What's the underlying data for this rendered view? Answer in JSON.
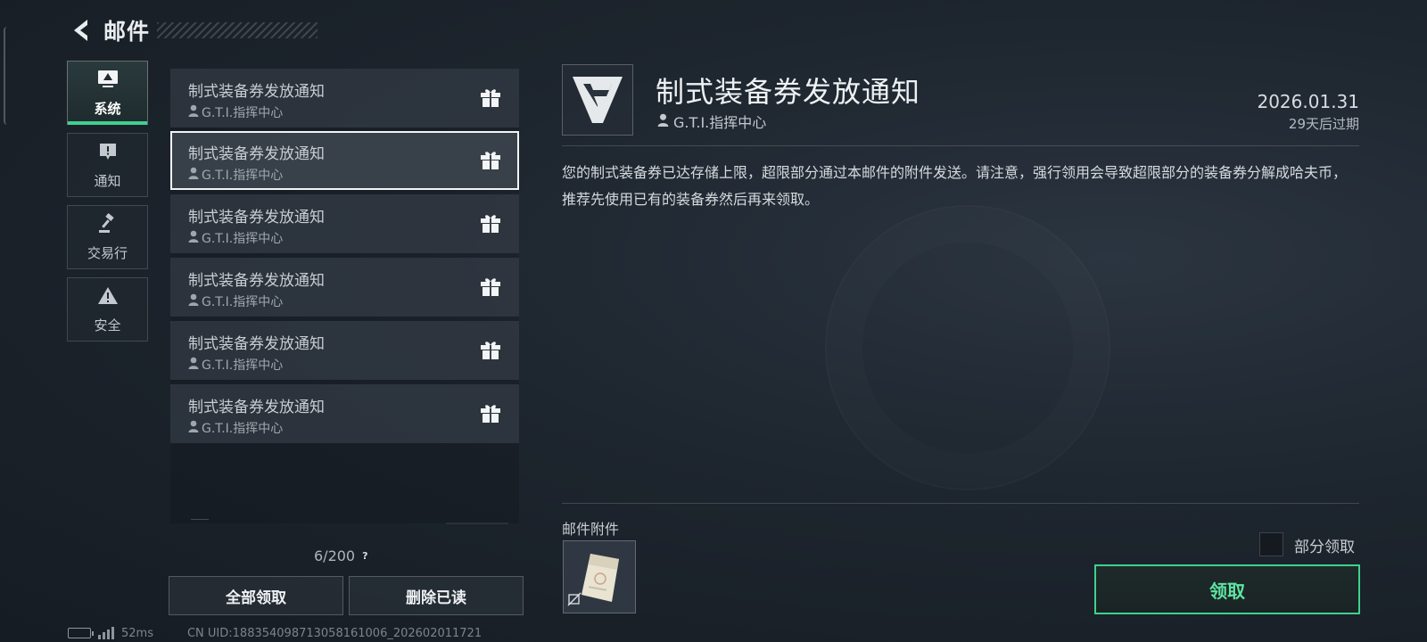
{
  "header": {
    "title": "邮件"
  },
  "categories": [
    {
      "label": "系统",
      "icon": "monitor-icon",
      "active": true
    },
    {
      "label": "通知",
      "icon": "exclamation-icon",
      "active": false
    },
    {
      "label": "交易行",
      "icon": "gavel-icon",
      "active": false
    },
    {
      "label": "安全",
      "icon": "warning-icon",
      "active": false
    }
  ],
  "mails": [
    {
      "title": "制式装备券发放通知",
      "sender": "G.T.I.指挥中心"
    },
    {
      "title": "制式装备券发放通知",
      "sender": "G.T.I.指挥中心"
    },
    {
      "title": "制式装备券发放通知",
      "sender": "G.T.I.指挥中心"
    },
    {
      "title": "制式装备券发放通知",
      "sender": "G.T.I.指挥中心"
    },
    {
      "title": "制式装备券发放通知",
      "sender": "G.T.I.指挥中心"
    },
    {
      "title": "制式装备券发放通知",
      "sender": "G.T.I.指挥中心"
    }
  ],
  "mail_count": "6/200",
  "help_label": "?",
  "buttons": {
    "claim_all": "全部领取",
    "delete_read": "删除已读"
  },
  "status": {
    "ping": "52ms",
    "uid": "CN UID:188354098713058161006_202602011721"
  },
  "detail": {
    "title": "制式装备券发放通知",
    "sender": "G.T.I.指挥中心",
    "date": "2026.01.31",
    "expire": "29天后过期",
    "body": "您的制式装备券已达存储上限，超限部分通过本邮件的附件发送。请注意，强行领用会导致超限部分的装备券分解成哈夫币，推荐先使用已有的装备券然后再来领取。",
    "attachments_label": "邮件附件",
    "partial_label": "部分领取",
    "claim_label": "领取"
  },
  "colors": {
    "accent": "#3fd18e",
    "selected_border": "#f2f4f5"
  }
}
